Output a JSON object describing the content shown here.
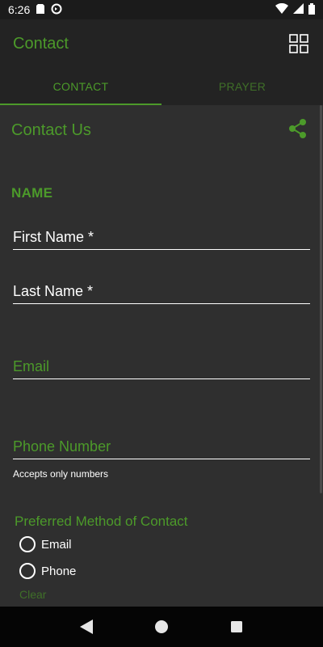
{
  "status_bar": {
    "time": "6:26"
  },
  "app_bar": {
    "title": "Contact"
  },
  "tabs": [
    {
      "label": "CONTACT",
      "active": true
    },
    {
      "label": "PRAYER",
      "active": false
    }
  ],
  "section": {
    "title": "Contact Us"
  },
  "form": {
    "name_heading": "NAME",
    "first_name_label": "First Name *",
    "last_name_label": "Last Name *",
    "email_label": "Email",
    "phone_label": "Phone Number",
    "phone_helper": "Accepts only numbers",
    "preferred_heading": "Preferred Method of Contact",
    "radio_options": [
      "Email",
      "Phone"
    ],
    "clear_label": "Clear"
  },
  "colors": {
    "accent": "#4c9a2a",
    "background": "#2f2f2f",
    "app_bar": "#232323"
  }
}
